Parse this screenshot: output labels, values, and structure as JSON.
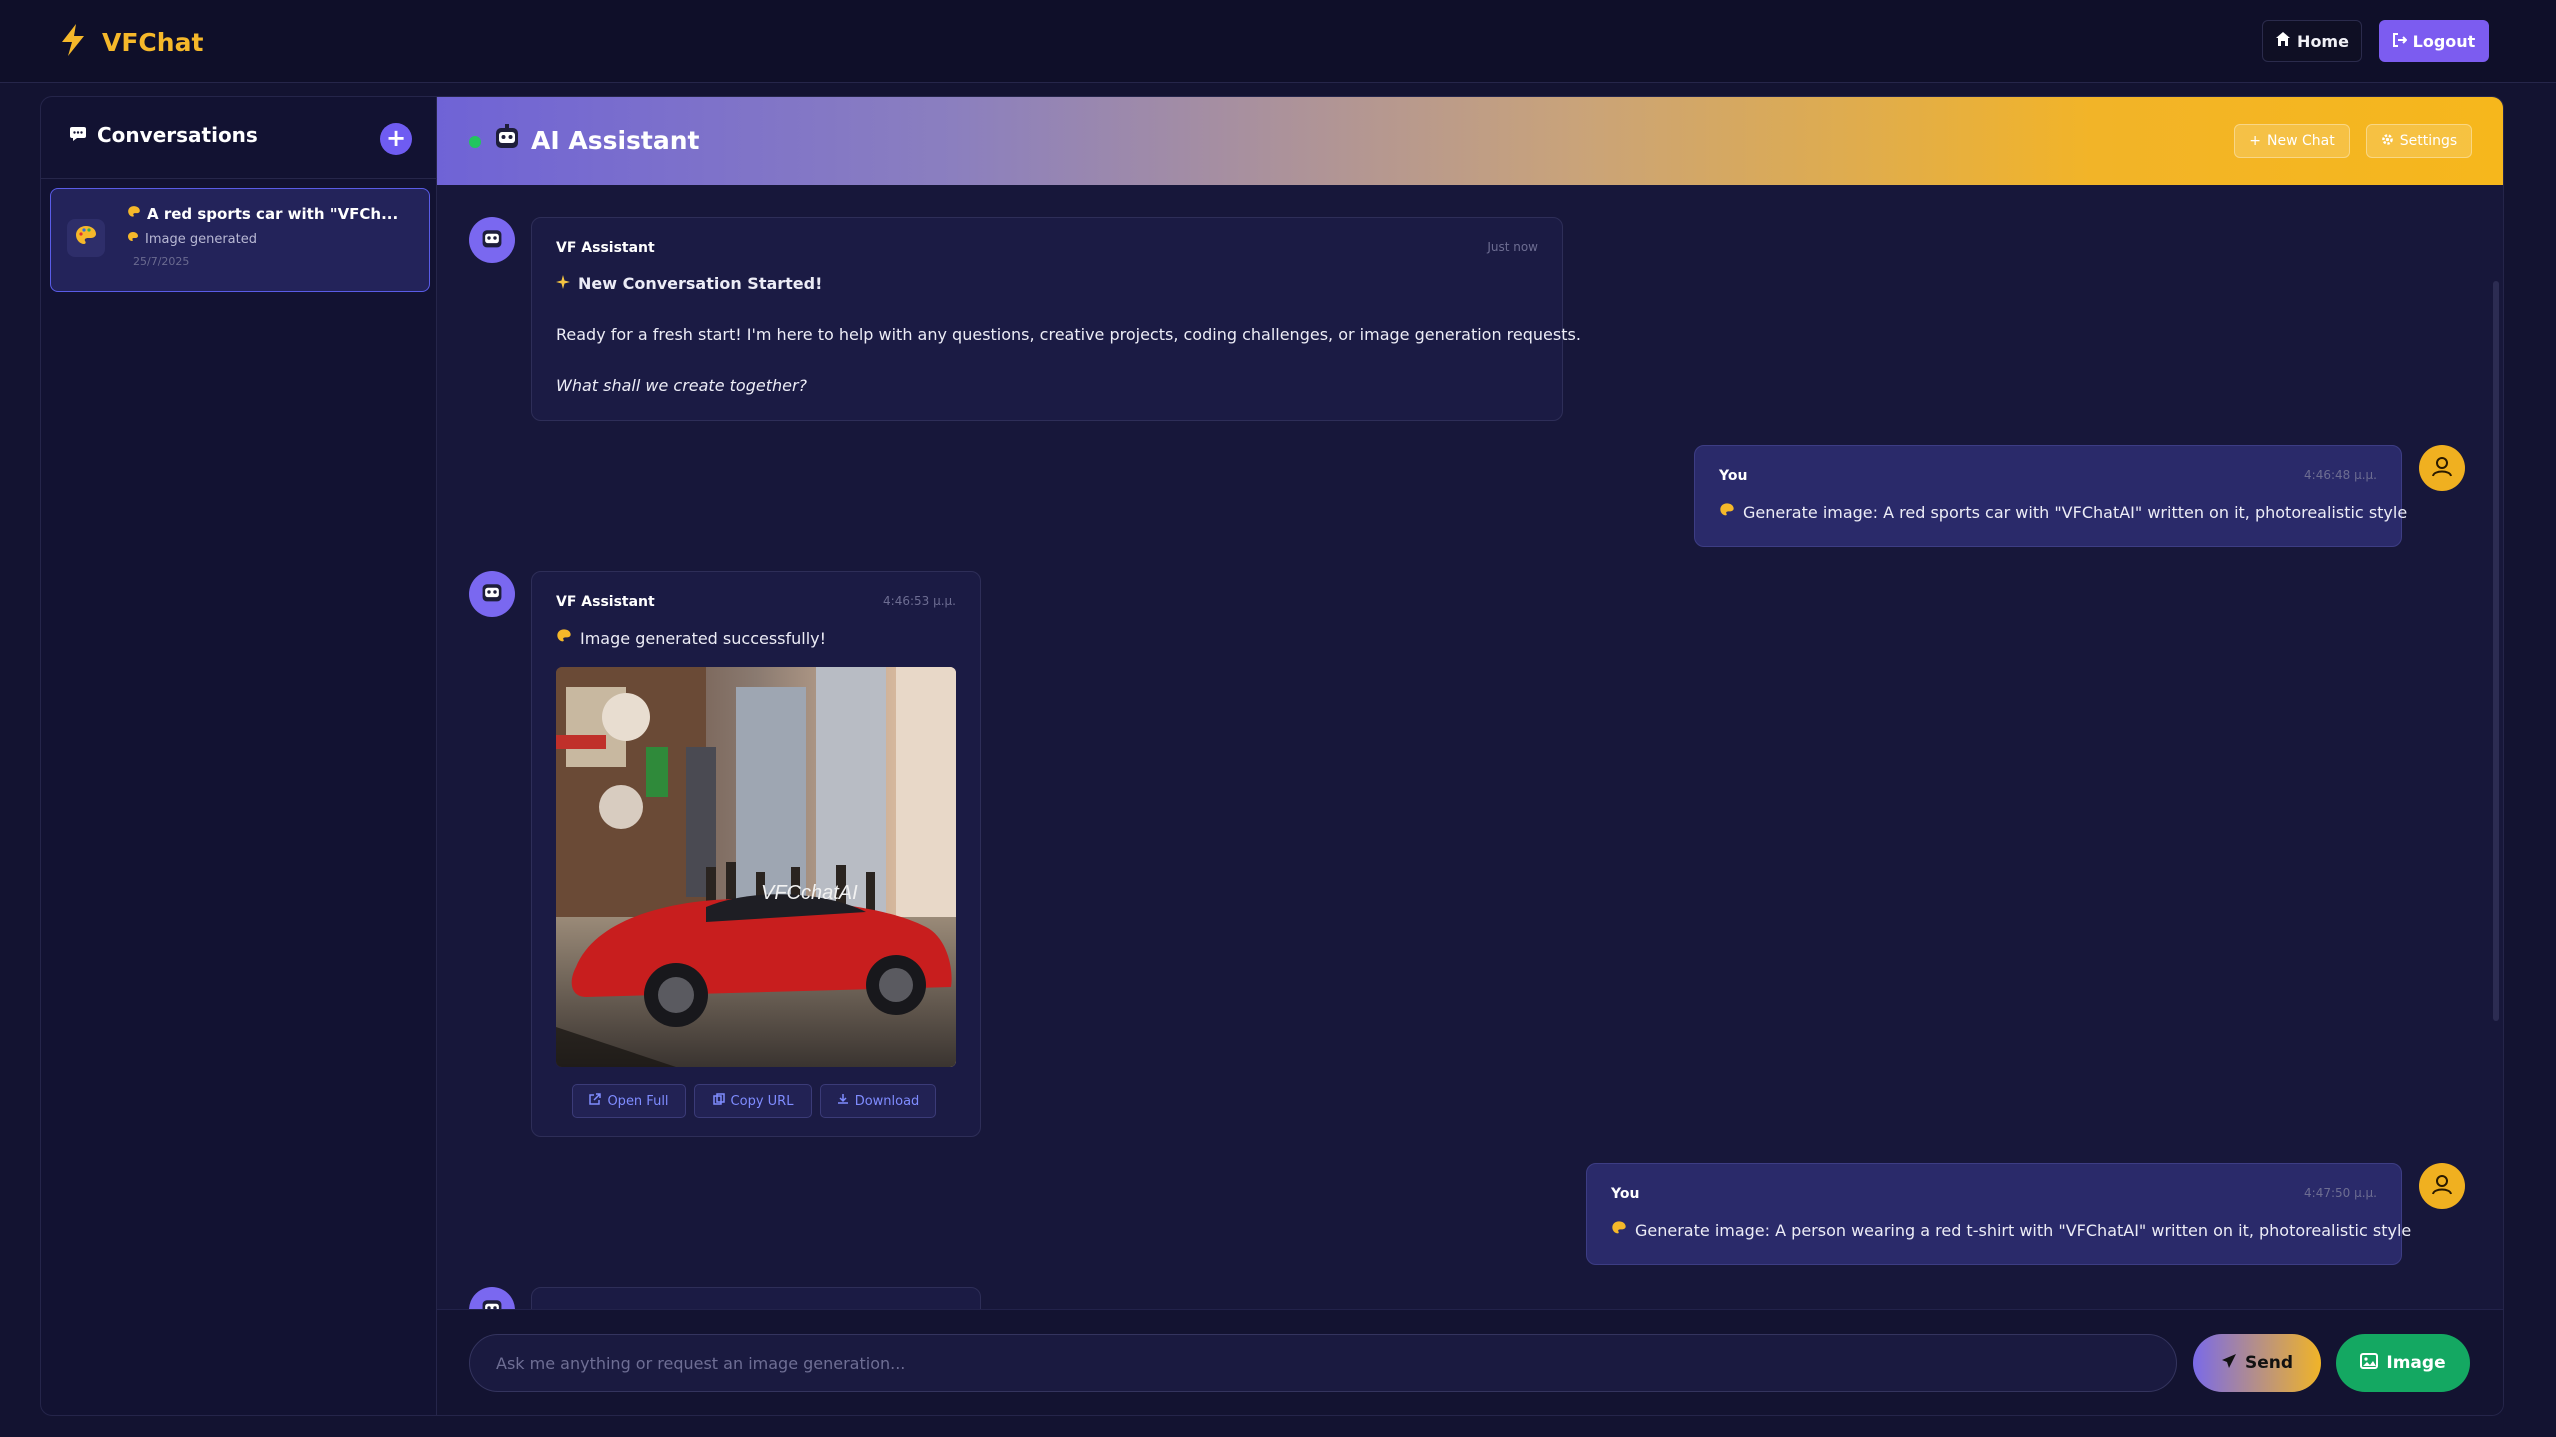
{
  "app": {
    "brand": "VFChat",
    "nav": {
      "home_label": "Home",
      "logout_label": "Logout"
    }
  },
  "sidebar": {
    "title": "Conversations",
    "add_label": "+",
    "conversations": [
      {
        "title": "A red sports car with \"VFCh...",
        "subtitle": "Image generated",
        "date": "25/7/2025"
      }
    ]
  },
  "chat": {
    "header": {
      "title": "AI Assistant",
      "new_chat_label": "New Chat",
      "settings_label": "Settings"
    },
    "messages": [
      {
        "sender": "VF Assistant",
        "time": "Just now",
        "title": "New Conversation Started!",
        "body": "Ready for a fresh start! I'm here to help with any questions, creative projects, coding challenges, or image generation requests.",
        "footer": "What shall we create together?"
      },
      {
        "sender": "You",
        "time": "4:46:48 μ.μ.",
        "text": "Generate image: A red sports car with \"VFChatAI\" written on it, photorealistic style"
      },
      {
        "sender": "VF Assistant",
        "time": "4:46:53 μ.μ.",
        "text": "Image generated successfully!",
        "image_caption": "VFCchatAI",
        "buttons": {
          "open": "Open Full",
          "copy": "Copy URL",
          "download": "Download"
        }
      },
      {
        "sender": "You",
        "time": "4:47:50 μ.μ.",
        "text": "Generate image: A person wearing a red t-shirt with \"VFChatAI\" written on it, photorealistic style"
      }
    ]
  },
  "input": {
    "placeholder": "Ask me anything or request an image generation...",
    "send_label": "Send",
    "image_label": "Image"
  },
  "colors": {
    "background": "#131331",
    "accent_purple": "#7c5cf0",
    "accent_gold": "#f5b82a",
    "success_green": "#14a862",
    "online": "#22c55e"
  }
}
